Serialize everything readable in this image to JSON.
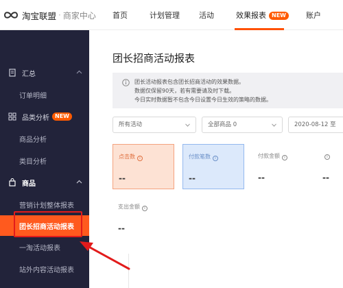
{
  "header": {
    "brand_name": "淘宝联盟",
    "brand_separator": "·",
    "brand_sub": "商家中心",
    "nav": [
      {
        "label": "首页"
      },
      {
        "label": "计划管理"
      },
      {
        "label": "活动"
      },
      {
        "label": "效果报表",
        "badge": "NEW",
        "active": true
      },
      {
        "label": "账户"
      }
    ]
  },
  "sidebar": {
    "groups": [
      {
        "label": "汇总",
        "icon": "receipt-icon",
        "expanded": true,
        "items": [
          {
            "label": "订单明细"
          }
        ]
      },
      {
        "label": "品类分析",
        "icon": "grid-icon",
        "badge": "NEW",
        "items": [
          {
            "label": "商品分析"
          },
          {
            "label": "类目分析"
          }
        ]
      },
      {
        "label": "商品",
        "icon": "bag-icon",
        "expanded": true,
        "items": [
          {
            "label": "营销计划整体报表"
          },
          {
            "label": "团长招商活动报表",
            "active": true
          },
          {
            "label": "一淘活动报表"
          },
          {
            "label": "站外内容活动报表"
          }
        ]
      }
    ]
  },
  "main": {
    "title": "团长招商活动报表",
    "notice_lines": [
      "团长活动报表包含团长招商活动的效果数据。",
      "数据仅保留90天，若有需要请及时下载。",
      "今日实时数据暂不包含今日设置今日生效的策略的数据。"
    ],
    "filters": {
      "activity": "所有活动",
      "goods": "全部商品 0",
      "date": "2020-08-12 至"
    },
    "metrics": [
      {
        "label": "点击数",
        "value": "--",
        "style": "orange"
      },
      {
        "label": "付款笔数",
        "value": "--",
        "style": "blue"
      },
      {
        "label": "付款金额",
        "value": "--",
        "style": "plain"
      },
      {
        "label": "",
        "value": "--",
        "style": "plain"
      },
      {
        "label": "支出金额",
        "value": "--",
        "style": "plain"
      }
    ]
  },
  "colors": {
    "accent": "#ff5000",
    "sidebar_bg": "#22233a",
    "active_item": "#ff5a1e",
    "annotation_red": "#e21b1b"
  }
}
